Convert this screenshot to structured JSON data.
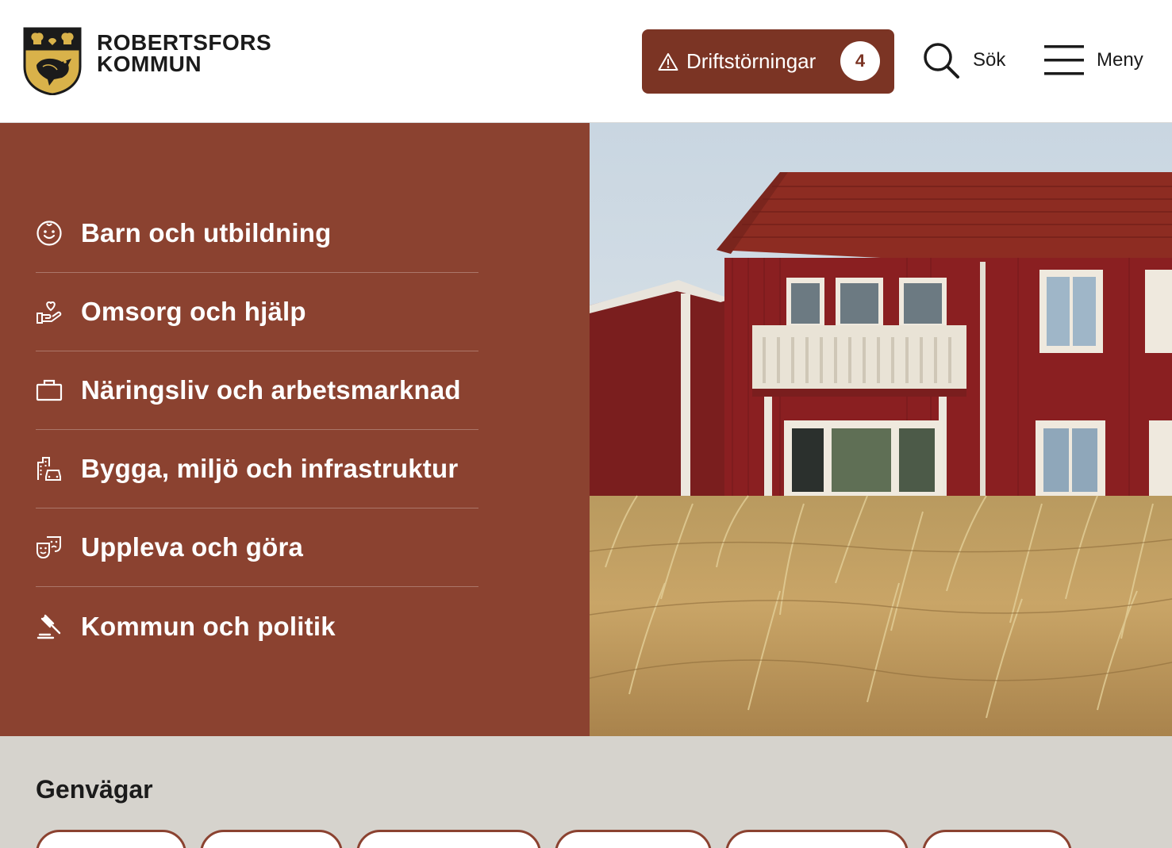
{
  "header": {
    "logo": {
      "line1": "ROBERTSFORS",
      "line2": "KOMMUN",
      "icon": "coat-of-arms"
    },
    "alert": {
      "label": "Driftstörningar",
      "count": "4",
      "icon": "warning-triangle-icon"
    },
    "search": {
      "label": "Sök",
      "icon": "search-icon"
    },
    "menu": {
      "label": "Meny",
      "icon": "hamburger-icon"
    }
  },
  "nav": {
    "items": [
      {
        "label": "Barn och utbildning",
        "icon": "smiley-child-icon"
      },
      {
        "label": "Omsorg och hjälp",
        "icon": "hand-heart-icon"
      },
      {
        "label": "Näringsliv och arbetsmarknad",
        "icon": "briefcase-icon"
      },
      {
        "label": "Bygga, miljö och infrastruktur",
        "icon": "buildings-car-icon"
      },
      {
        "label": "Uppleva och göra",
        "icon": "theater-masks-icon"
      },
      {
        "label": "Kommun och politik",
        "icon": "gavel-icon"
      }
    ]
  },
  "shortcuts": {
    "title": "Genvägar"
  },
  "colors": {
    "brand": "#8b4230",
    "alert": "#7b3424",
    "shortcuts_bg": "#d6d3cd"
  }
}
